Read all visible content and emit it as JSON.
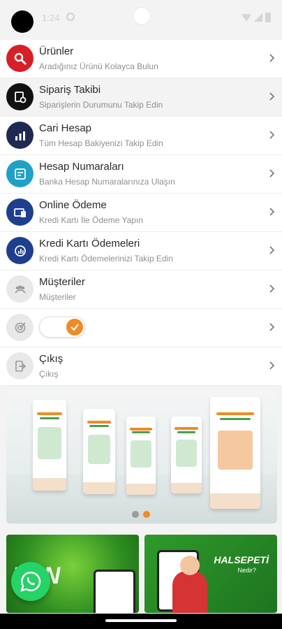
{
  "status_bar": {
    "time": "1:24"
  },
  "menu": {
    "items": [
      {
        "title": "Ürünler",
        "subtitle": "Aradığınız Ürünü Kolayca Bulun",
        "icon": "search-icon",
        "color": "#d61f26"
      },
      {
        "title": "Sipariş Takibi",
        "subtitle": "Siparişlerin Durumunu Takip Edin",
        "icon": "order-tracking-icon",
        "color": "#111111"
      },
      {
        "title": "Cari Hesap",
        "subtitle": "Tüm Hesap Bakiyenizi Takip Edin",
        "icon": "account-chart-icon",
        "color": "#1e2a52"
      },
      {
        "title": "Hesap Numaraları",
        "subtitle": "Banka Hesap Numaralarınıza Ulaşın",
        "icon": "bank-account-icon",
        "color": "#1fa1c6"
      },
      {
        "title": "Online Ödeme",
        "subtitle": "Kredi Kartı İle Ödeme Yapın",
        "icon": "online-payment-icon",
        "color": "#1c3f8e"
      },
      {
        "title": "Kredi Kartı Ödemeleri",
        "subtitle": "Kredi Kartı Ödemelerinizi Takip Edin",
        "icon": "card-payments-icon",
        "color": "#1c3f8e"
      },
      {
        "title": "Müşteriler",
        "subtitle": "Müşteriler",
        "icon": "customers-icon",
        "color": "#e8e8e8"
      }
    ],
    "toggle": {
      "icon": "target-icon",
      "state": "on"
    },
    "logout": {
      "title": "Çıkış",
      "subtitle": "Çıkış",
      "icon": "logout-icon"
    }
  },
  "banner": {
    "slides": 2,
    "active_slide": 2
  },
  "promo": {
    "left_text": "TAN",
    "right_brand": "HALSEPETİ",
    "right_sub": "Nedir?"
  },
  "colors": {
    "accent": "#f08a24",
    "brand_green": "#2f8f22"
  }
}
